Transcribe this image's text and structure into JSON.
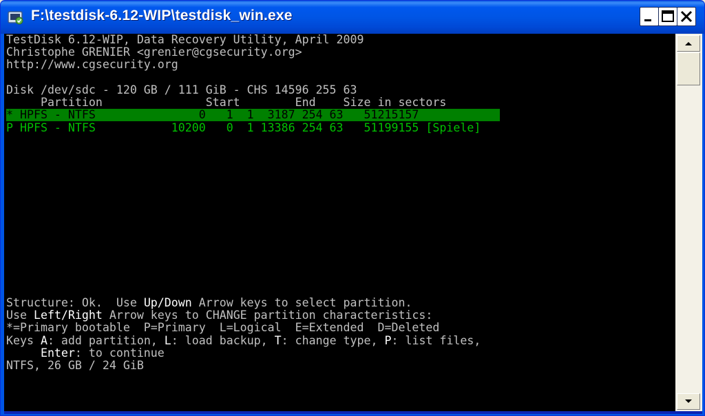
{
  "window": {
    "title": "F:\\testdisk-6.12-WIP\\testdisk_win.exe",
    "icon": "console-app-icon",
    "controls": [
      "minimize",
      "maximize",
      "close"
    ]
  },
  "console": {
    "header": [
      "TestDisk 6.12-WIP, Data Recovery Utility, April 2009",
      "Christophe GRENIER <grenier@cgsecurity.org>",
      "http://www.cgsecurity.org"
    ],
    "disk_line": "Disk /dev/sdc - 120 GB / 111 GiB - CHS 14596 255 63",
    "columns_line": "     Partition               Start        End    Size in sectors",
    "partitions": [
      {
        "text": "* HPFS - NTFS               0   1  1  3187 254 63   51215157",
        "status": "*",
        "type": "HPFS - NTFS",
        "start": "0 1 1",
        "end": "3187 254 63",
        "size_in_sectors": "51215157",
        "label": "",
        "selected": true
      },
      {
        "text": "P HPFS - NTFS           10200   0  1 13386 254 63   51199155 [Spiele]",
        "status": "P",
        "type": "HPFS - NTFS",
        "start": "10200 0 1",
        "end": "13386 254 63",
        "size_in_sectors": "51199155",
        "label": "[Spiele]",
        "selected": false
      }
    ],
    "help": {
      "l1_a": "Structure: Ok.  Use ",
      "l1_key": "Up/Down",
      "l1_b": " Arrow keys to select partition.",
      "l2_a": "Use ",
      "l2_key": "Left/Right",
      "l2_b": " Arrow keys to CHANGE partition characteristics:",
      "l3": "*=Primary bootable  P=Primary  L=Logical  E=Extended  D=Deleted",
      "l4_a": "Keys ",
      "l4_key1": "A",
      "l4_b": ": add partition, ",
      "l4_key2": "L",
      "l4_c": ": load backup, ",
      "l4_key3": "T",
      "l4_d": ": change type, ",
      "l4_key4": "P",
      "l4_e": ": list files,",
      "l5_indent": "     ",
      "l5_key": "Enter",
      "l5_b": ": to continue",
      "l6": "NTFS, 26 GB / 24 GiB"
    }
  },
  "colors": {
    "titlebar": "#0055E5",
    "console_bg": "#000000",
    "console_text": "#C0C0C0",
    "highlight_bg": "#008000",
    "partition_text": "#00C000"
  }
}
